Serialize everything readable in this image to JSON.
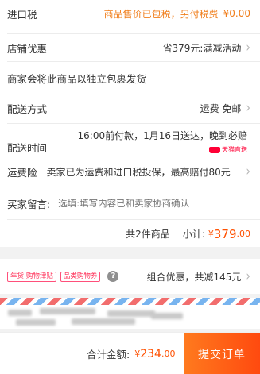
{
  "import_tax": {
    "label": "进口税",
    "notice": "商品售价已包税，另付税费",
    "amount": "¥0.00"
  },
  "shop_discount": {
    "label": "店铺优惠",
    "value": "省379元:满减活动"
  },
  "separate_shipping_notice": "商家会将此商品以独立包裹发货",
  "delivery_method": {
    "label": "配送方式",
    "value": "运费 免邮"
  },
  "delivery_time": {
    "label": "配送时间",
    "value": "16:00前付款，1月16日送达，晚到必赔",
    "badge": "天猫直送"
  },
  "shipping_insurance": {
    "label": "运费险",
    "value": "卖家已为运费和进口税投保，最高赔付80元"
  },
  "buyer_message": {
    "label": "买家留言:",
    "placeholder": "选填:填写内容已和卖家协商确认"
  },
  "subtotal": {
    "count_text": "共2件商品",
    "label": "小计:",
    "currency": "¥",
    "amount": "379",
    "cents": ".00"
  },
  "promotions": {
    "tags": [
      "年货|购物津贴",
      "品类购物券"
    ],
    "summary": "组合优惠，共减145元"
  },
  "footer": {
    "total_label": "合计金额:",
    "currency": "¥",
    "total": "234",
    "cents": ".00",
    "submit_label": "提交订单"
  },
  "colors": {
    "accent": "#ff5000",
    "notice": "#f07d1a",
    "tag": "#ff2d55"
  }
}
